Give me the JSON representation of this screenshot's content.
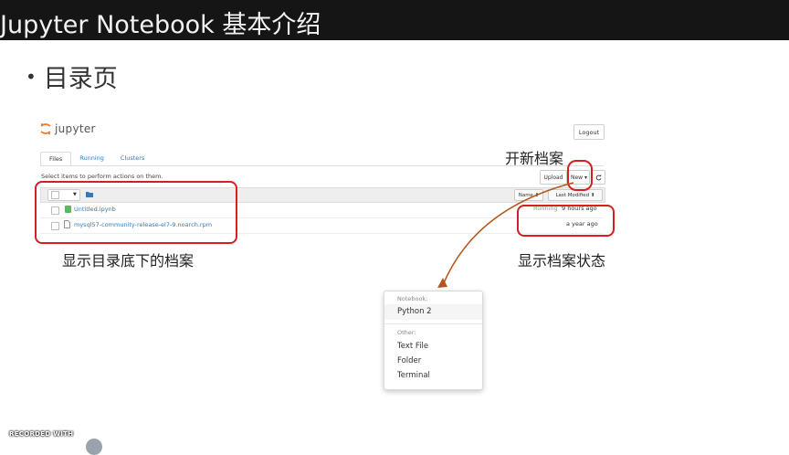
{
  "slide": {
    "title": "Jupyter Notebook 基本介绍",
    "bullet": "目录页"
  },
  "jupyter": {
    "logo_text": "jupyter",
    "logout_label": "Logout",
    "tabs": [
      {
        "label": "Files",
        "active": true
      },
      {
        "label": "Running",
        "active": false
      },
      {
        "label": "Clusters",
        "active": false
      }
    ],
    "hint": "Select items to perform actions on them.",
    "upload_label": "Upload",
    "new_label": "New ▾",
    "refresh_icon": "refresh-icon",
    "sort_name": "Name ⬆",
    "sort_modified": "Last Modified ⬆",
    "files": [
      {
        "name": "Untitled.ipynb",
        "icon": "notebook-icon",
        "status": "Running",
        "modified": "9 hours ago"
      },
      {
        "name": "mysql57-community-release-el7-9.noarch.rpm",
        "icon": "file-icon",
        "status": "",
        "modified": "a year ago"
      }
    ],
    "accent_color": "#f37726",
    "link_color": "#337ab7",
    "running_color": "#5cb85c"
  },
  "annotations": {
    "new_file": "开新档案",
    "file_list": "显示目录底下的档案",
    "file_status": "显示档案状态",
    "highlight_color": "#d42020",
    "arrow_color": "#b5561e"
  },
  "new_menu": {
    "notebook_header": "Notebook:",
    "notebook_items": [
      "Python 2"
    ],
    "other_header": "Other:",
    "other_items": [
      "Text File",
      "Folder",
      "Terminal"
    ]
  },
  "watermark": "RECORDED WITH"
}
